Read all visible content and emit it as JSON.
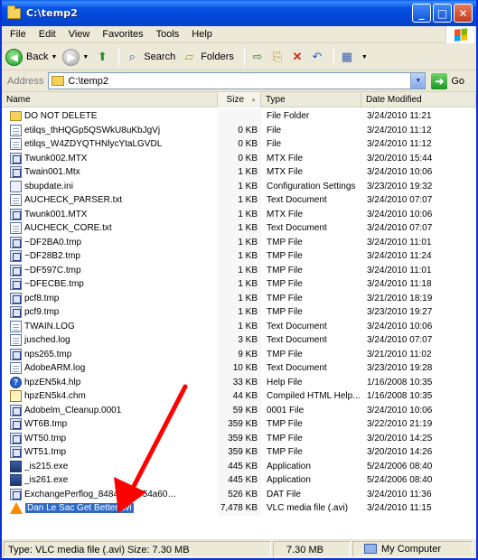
{
  "window": {
    "title": "C:\\temp2"
  },
  "menu": [
    "File",
    "Edit",
    "View",
    "Favorites",
    "Tools",
    "Help"
  ],
  "toolbar": {
    "back": "Back",
    "search": "Search",
    "folders": "Folders"
  },
  "address": {
    "label": "Address",
    "value": "C:\\temp2",
    "go": "Go"
  },
  "columns": {
    "name": "Name",
    "size": "Size",
    "type": "Type",
    "date": "Date Modified"
  },
  "files": [
    {
      "name": "DO NOT DELETE",
      "size": "",
      "type": "File Folder",
      "date": "3/24/2010 11:21",
      "icon": "folder"
    },
    {
      "name": "etilqs_thHQGp5QSWkU8uKbJgVj",
      "size": "0 KB",
      "type": "File",
      "date": "3/24/2010 11:12",
      "icon": "file"
    },
    {
      "name": "etilqs_W4ZDYQTHNlycYtaLGVDL",
      "size": "0 KB",
      "type": "File",
      "date": "3/24/2010 11:12",
      "icon": "file"
    },
    {
      "name": "Twunk002.MTX",
      "size": "0 KB",
      "type": "MTX File",
      "date": "3/20/2010 15:44",
      "icon": "mtx"
    },
    {
      "name": "Twain001.Mtx",
      "size": "1 KB",
      "type": "MTX File",
      "date": "3/24/2010 10:06",
      "icon": "mtx"
    },
    {
      "name": "sbupdate.ini",
      "size": "1 KB",
      "type": "Configuration Settings",
      "date": "3/23/2010 19:32",
      "icon": "ini"
    },
    {
      "name": "AUCHECK_PARSER.txt",
      "size": "1 KB",
      "type": "Text Document",
      "date": "3/24/2010 07:07",
      "icon": "file"
    },
    {
      "name": "Twunk001.MTX",
      "size": "1 KB",
      "type": "MTX File",
      "date": "3/24/2010 10:06",
      "icon": "mtx"
    },
    {
      "name": "AUCHECK_CORE.txt",
      "size": "1 KB",
      "type": "Text Document",
      "date": "3/24/2010 07:07",
      "icon": "file"
    },
    {
      "name": "~DF2BA0.tmp",
      "size": "1 KB",
      "type": "TMP File",
      "date": "3/24/2010 11:01",
      "icon": "mtx"
    },
    {
      "name": "~DF28B2.tmp",
      "size": "1 KB",
      "type": "TMP File",
      "date": "3/24/2010 11:24",
      "icon": "mtx"
    },
    {
      "name": "~DF597C.tmp",
      "size": "1 KB",
      "type": "TMP File",
      "date": "3/24/2010 11:01",
      "icon": "mtx"
    },
    {
      "name": "~DFECBE.tmp",
      "size": "1 KB",
      "type": "TMP File",
      "date": "3/24/2010 11:18",
      "icon": "mtx"
    },
    {
      "name": "pcf8.tmp",
      "size": "1 KB",
      "type": "TMP File",
      "date": "3/21/2010 18:19",
      "icon": "mtx"
    },
    {
      "name": "pcf9.tmp",
      "size": "1 KB",
      "type": "TMP File",
      "date": "3/23/2010 19:27",
      "icon": "mtx"
    },
    {
      "name": "TWAIN.LOG",
      "size": "1 KB",
      "type": "Text Document",
      "date": "3/24/2010 10:06",
      "icon": "file"
    },
    {
      "name": "jusched.log",
      "size": "3 KB",
      "type": "Text Document",
      "date": "3/24/2010 07:07",
      "icon": "file"
    },
    {
      "name": "nps265.tmp",
      "size": "9 KB",
      "type": "TMP File",
      "date": "3/21/2010 11:02",
      "icon": "mtx"
    },
    {
      "name": "AdobeARM.log",
      "size": "10 KB",
      "type": "Text Document",
      "date": "3/23/2010 19:28",
      "icon": "file"
    },
    {
      "name": "hpzEN5k4.hlp",
      "size": "33 KB",
      "type": "Help File",
      "date": "1/16/2008 10:35",
      "icon": "help"
    },
    {
      "name": "hpzEN5k4.chm",
      "size": "44 KB",
      "type": "Compiled HTML Help...",
      "date": "1/16/2008 10:35",
      "icon": "chm"
    },
    {
      "name": "Adobelm_Cleanup.0001",
      "size": "59 KB",
      "type": "0001 File",
      "date": "3/24/2010 10:06",
      "icon": "mtx"
    },
    {
      "name": "WT6B.tmp",
      "size": "359 KB",
      "type": "TMP File",
      "date": "3/22/2010 21:19",
      "icon": "mtx"
    },
    {
      "name": "WT50.tmp",
      "size": "359 KB",
      "type": "TMP File",
      "date": "3/20/2010 14:25",
      "icon": "mtx"
    },
    {
      "name": "WT51.tmp",
      "size": "359 KB",
      "type": "TMP File",
      "date": "3/20/2010 14:26",
      "icon": "mtx"
    },
    {
      "name": "_is215.exe",
      "size": "445 KB",
      "type": "Application",
      "date": "5/24/2006 08:40",
      "icon": "exe"
    },
    {
      "name": "_is261.exe",
      "size": "445 KB",
      "type": "Application",
      "date": "5/24/2006 08:40",
      "icon": "exe"
    },
    {
      "name": "ExchangePerflog_8484…31954a60…",
      "size": "526 KB",
      "type": "DAT File",
      "date": "3/24/2010 11:36",
      "icon": "mtx"
    },
    {
      "name": "Dan Le Sac Get Better.avi",
      "size": "7,478 KB",
      "type": "VLC media file (.avi)",
      "date": "3/24/2010 11:15",
      "icon": "vlc",
      "selected": true
    }
  ],
  "status": {
    "type": "Type: VLC media file (.avi) Size: 7.30 MB",
    "size": "7.30 MB",
    "location": "My Computer"
  },
  "colors": {
    "titlebar": "#0653e4",
    "selection": "#316ac5",
    "annotation_arrow": "#ff0000"
  }
}
